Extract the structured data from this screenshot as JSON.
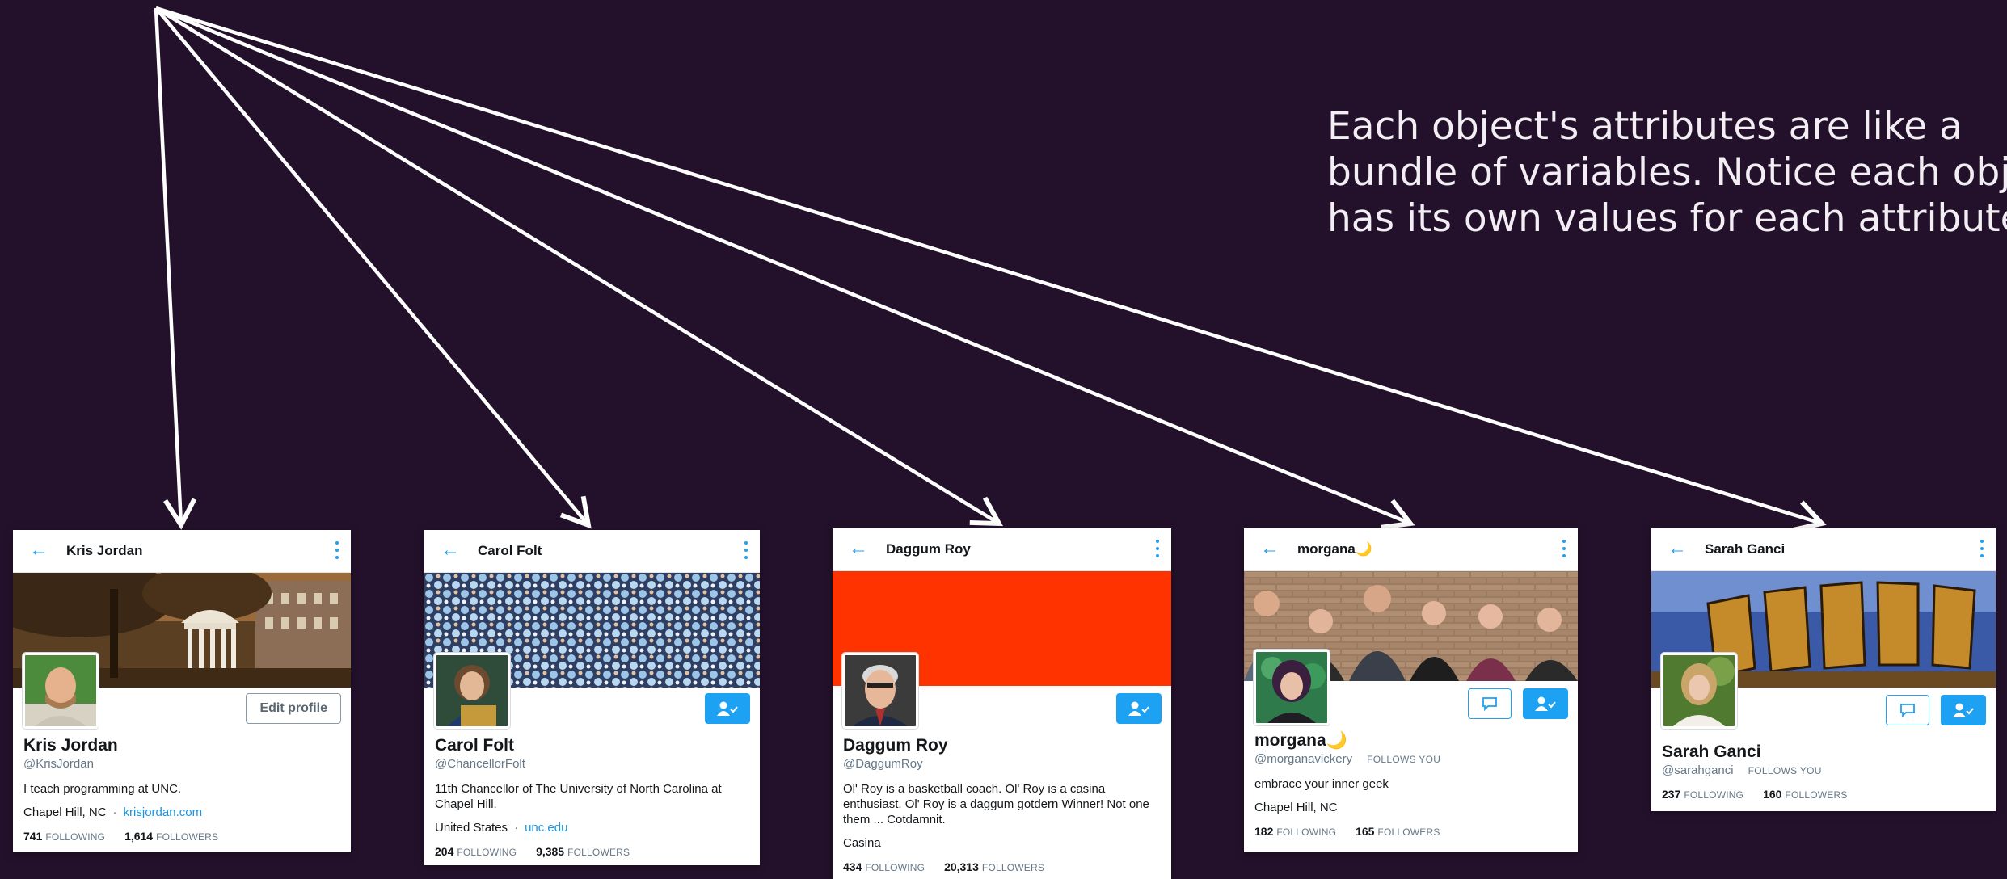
{
  "caption": {
    "lines": [
      "Each object's attributes are like a",
      "bundle of variables. Notice each object",
      "has its own values for each attribute."
    ]
  },
  "colors": {
    "background": "#23112b",
    "accent": "#1da1f2",
    "daggum_banner": "#ff3300"
  },
  "icons": {
    "back": "back-arrow-icon",
    "menu": "more-vertical-icon",
    "follow": "following-user-icon",
    "message": "message-icon"
  },
  "profiles": [
    {
      "top_name": "Kris Jordan",
      "name": "Kris Jordan",
      "handle": "@KrisJordan",
      "follows_you": "",
      "bio": "I teach programming at UNC.",
      "location": "Chapel Hill, NC",
      "link": "krisjordan.com",
      "following": "741",
      "followers": "1,614",
      "following_label": "FOLLOWING",
      "followers_label": "FOLLOWERS",
      "edit_label": "Edit profile"
    },
    {
      "top_name": "Carol Folt",
      "name": "Carol Folt",
      "handle": "@ChancellorFolt",
      "follows_you": "",
      "bio": "11th Chancellor of The University of North Carolina at Chapel Hill.",
      "location": "United States",
      "link": "unc.edu",
      "following": "204",
      "followers": "9,385",
      "following_label": "FOLLOWING",
      "followers_label": "FOLLOWERS"
    },
    {
      "top_name": "Daggum Roy",
      "name": "Daggum Roy",
      "handle": "@DaggumRoy",
      "follows_you": "",
      "bio": "Ol' Roy is a basketball coach. Ol' Roy is a casina enthusiast. Ol' Roy is a daggum gotdern Winner! Not one them ... Cotdamnit.",
      "location": "Casina",
      "link": "",
      "following": "434",
      "followers": "20,313",
      "following_label": "FOLLOWING",
      "followers_label": "FOLLOWERS"
    },
    {
      "top_name": "morgana🌙",
      "name": "morgana🌙",
      "handle": "@morganavickery",
      "follows_you": "FOLLOWS YOU",
      "bio": "embrace your inner geek",
      "location": "Chapel Hill, NC",
      "link": "",
      "following": "182",
      "followers": "165",
      "following_label": "FOLLOWING",
      "followers_label": "FOLLOWERS"
    },
    {
      "top_name": "Sarah Ganci",
      "name": "Sarah Ganci",
      "handle": "@sarahganci",
      "follows_you": "FOLLOWS YOU",
      "bio": "",
      "location": "",
      "link": "",
      "following": "237",
      "followers": "160",
      "following_label": "FOLLOWING",
      "followers_label": "FOLLOWERS"
    }
  ]
}
